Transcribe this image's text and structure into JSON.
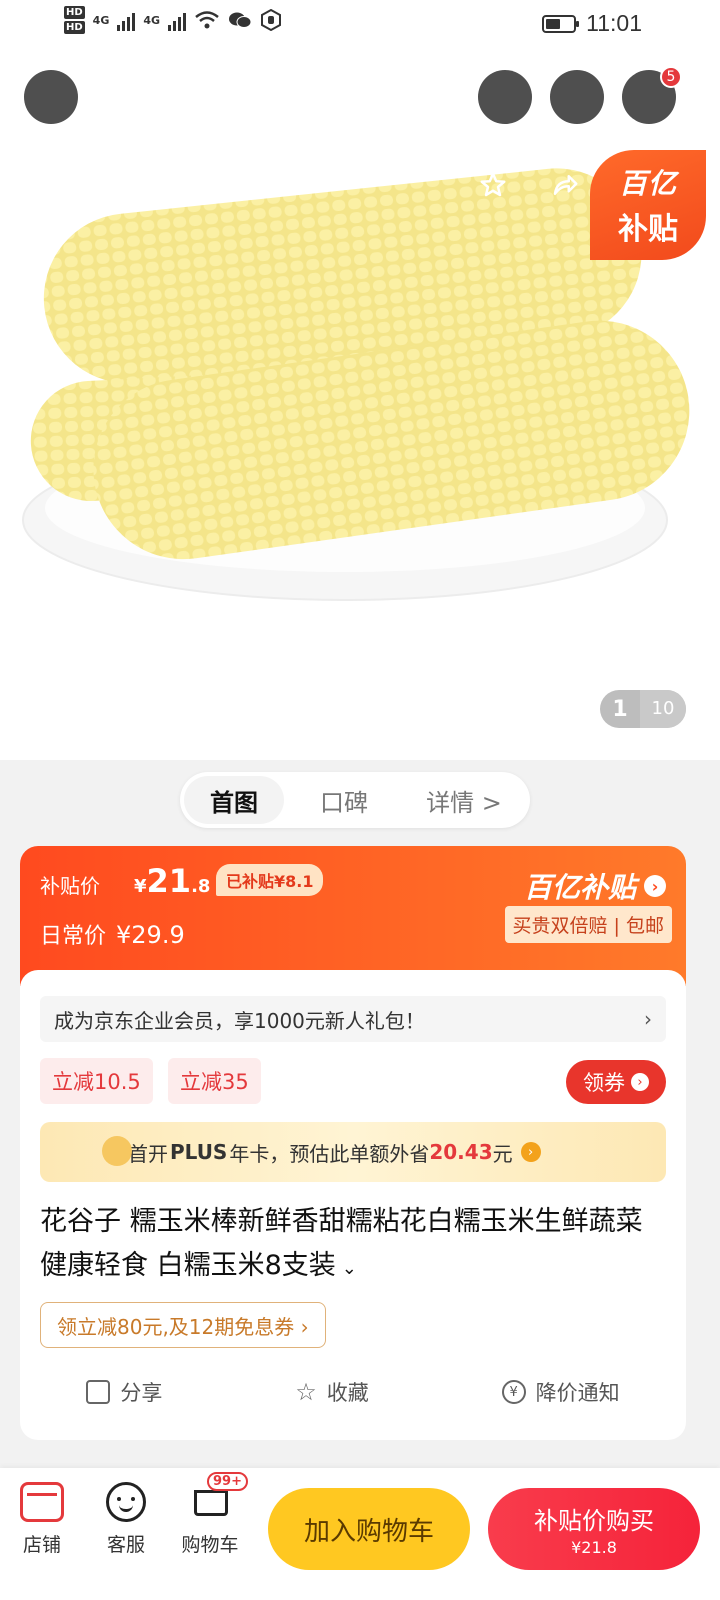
{
  "status_bar": {
    "hd1": "HD",
    "hd2": "HD",
    "net1": "4G",
    "net2": "4G",
    "time": "11:01"
  },
  "nav": {
    "more_badge": "5"
  },
  "gallery": {
    "badge_line1": "百亿",
    "badge_line2": "补贴",
    "current_page": "1",
    "total_pages": "10"
  },
  "tabs": [
    "首图",
    "口碑",
    "详情 >"
  ],
  "price": {
    "label": "补贴价",
    "currency": "¥",
    "integer": "21",
    "decimal": ".8",
    "subsidy_tag": "已补贴¥8.1",
    "daily_label": "日常价",
    "daily_price": "¥29.9",
    "brand": "百亿补贴",
    "guarantee": "买贵双倍赔 | 包邮"
  },
  "promo": {
    "membership": "成为京东企业会员，享1000元新人礼包！",
    "membership_chevron": "›",
    "chips": [
      "立减10.5",
      "立减35"
    ],
    "coupon_button": "领券",
    "plus_prefix": "首开",
    "plus_word": "PLUS",
    "plus_mid": "年卡，预估此单额外省",
    "plus_amount": "20.43",
    "plus_unit": "元"
  },
  "product": {
    "title": "花谷子 糯玉米棒新鲜香甜糯粘花白糯玉米生鲜蔬菜 健康轻食 白糯玉米8支装",
    "installment": "领立减80元,及12期免息券 ›"
  },
  "actions": [
    "分享",
    "收藏",
    "降价通知"
  ],
  "bottom_bar": {
    "shop": "店铺",
    "service": "客服",
    "cart": "购物车",
    "cart_badge": "99+",
    "add_to_cart": "加入购物车",
    "buy_line1": "补贴价购买",
    "buy_line2": "¥21.8"
  },
  "colors": {
    "accent": "#e4393c",
    "subsidy_orange": "#ff5a24",
    "cart_yellow": "#ffc821"
  }
}
